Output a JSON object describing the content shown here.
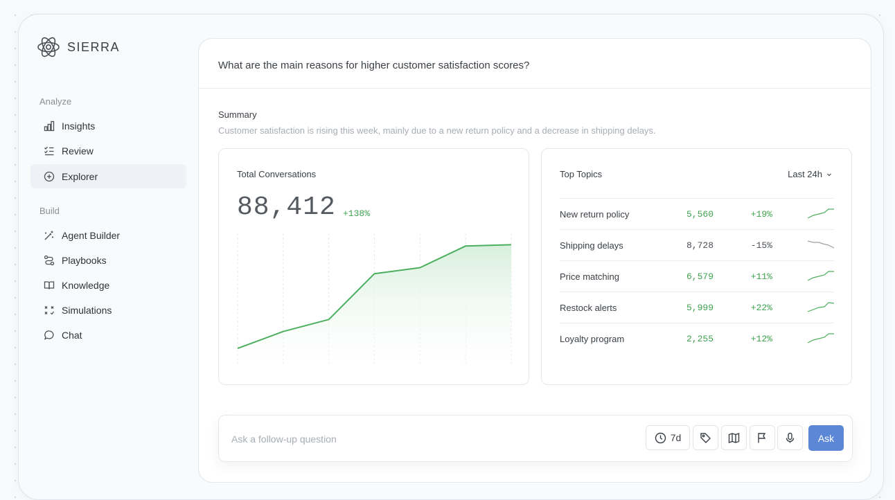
{
  "brand": {
    "name": "SIERRA"
  },
  "sidebar": {
    "sections": [
      {
        "label": "Analyze",
        "items": [
          {
            "label": "Insights",
            "icon": "bar-chart-icon"
          },
          {
            "label": "Review",
            "icon": "checklist-icon"
          },
          {
            "label": "Explorer",
            "icon": "plus-circle-icon",
            "active": true
          }
        ]
      },
      {
        "label": "Build",
        "items": [
          {
            "label": "Agent Builder",
            "icon": "magic-wand-icon"
          },
          {
            "label": "Playbooks",
            "icon": "route-icon"
          },
          {
            "label": "Knowledge",
            "icon": "book-icon"
          },
          {
            "label": "Simulations",
            "icon": "shuffle-icon"
          },
          {
            "label": "Chat",
            "icon": "chat-bubble-icon"
          }
        ]
      }
    ]
  },
  "main": {
    "question": "What are the main reasons for higher customer satisfaction scores?",
    "summary": {
      "title": "Summary",
      "text": "Customer satisfaction is rising this week, mainly due to a new return policy and a decrease in shipping delays."
    },
    "conversations": {
      "title": "Total Conversations",
      "value": "88,412",
      "change": "+138%"
    },
    "topics": {
      "title": "Top Topics",
      "range": "Last 24h",
      "rows": [
        {
          "name": "New return policy",
          "count": "5,560",
          "change": "+19%",
          "trend": "up"
        },
        {
          "name": "Shipping delays",
          "count": "8,728",
          "change": "-15%",
          "trend": "down"
        },
        {
          "name": "Price matching",
          "count": "6,579",
          "change": "+11%",
          "trend": "up"
        },
        {
          "name": "Restock alerts",
          "count": "5,999",
          "change": "+22%",
          "trend": "up"
        },
        {
          "name": "Loyalty program",
          "count": "2,255",
          "change": "+12%",
          "trend": "up"
        }
      ]
    }
  },
  "ask": {
    "placeholder": "Ask a follow-up question",
    "time_filter": "7d",
    "button_label": "Ask"
  },
  "colors": {
    "accent": "#5b87d6",
    "positive": "#3ea24f",
    "chart_line": "#4caf5e",
    "chart_fill": "#dff2e3"
  },
  "chart_data": {
    "type": "area",
    "x": [
      1,
      2,
      3,
      4,
      5,
      6,
      7
    ],
    "values": [
      8,
      22,
      32,
      70,
      75,
      93,
      94
    ],
    "ylim": [
      0,
      100
    ],
    "grid": "vertical-dashed",
    "legend": "none"
  }
}
